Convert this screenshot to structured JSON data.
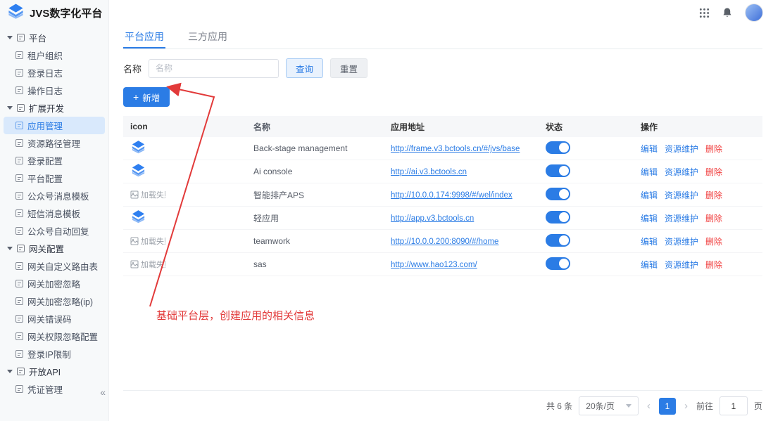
{
  "brand": {
    "title": "JVS数字化平台"
  },
  "sidebar": {
    "groups": [
      {
        "label": "平台",
        "items": [
          "租户组织",
          "登录日志",
          "操作日志"
        ]
      },
      {
        "label": "扩展开发",
        "items": [
          "应用管理",
          "资源路径管理",
          "登录配置",
          "平台配置",
          "公众号消息模板",
          "短信消息模板",
          "公众号自动回复"
        ]
      },
      {
        "label": "网关配置",
        "items": [
          "网关自定义路由表",
          "网关加密忽略",
          "网关加密忽略(ip)",
          "网关错误码",
          "网关权限忽略配置",
          "登录IP限制"
        ]
      },
      {
        "label": "开放API",
        "items": [
          "凭证管理"
        ]
      }
    ],
    "active_item": "应用管理",
    "collapse_glyph": "«"
  },
  "tabs": {
    "items": [
      {
        "label": "平台应用",
        "active": true
      },
      {
        "label": "三方应用",
        "active": false
      }
    ]
  },
  "search": {
    "label": "名称",
    "input_placeholder": "名称",
    "query_button": "查询",
    "reset_button": "重置"
  },
  "toolbar": {
    "plus_glyph": "+",
    "add_label": "新增"
  },
  "annotation": {
    "text": "基础平台层，创建应用的相关信息"
  },
  "table": {
    "columns": [
      "icon",
      "名称",
      "应用地址",
      "状态",
      "操作"
    ],
    "action_labels": {
      "edit": "编辑",
      "maintain": "资源维护",
      "delete": "删除"
    },
    "broken_icon_text": "加载失败",
    "rows": [
      {
        "icon": "jvs",
        "name": "Back-stage management",
        "url": "http://frame.v3.bctools.cn/#/jvs/base",
        "status": "on"
      },
      {
        "icon": "jvs",
        "name": "Ai console",
        "url": "http://ai.v3.bctools.cn",
        "status": "on"
      },
      {
        "icon": "broken",
        "name": "智能排产APS",
        "url": "http://10.0.0.174:9998/#/wel/index",
        "status": "on"
      },
      {
        "icon": "jvs",
        "name": "轻应用",
        "url": "http://app.v3.bctools.cn",
        "status": "on"
      },
      {
        "icon": "broken",
        "name": "teamwork",
        "url": "http://10.0.0.200:8090/#/home",
        "status": "on"
      },
      {
        "icon": "broken",
        "name": "sas",
        "url": "http://www.hao123.com/",
        "status": "on"
      }
    ]
  },
  "pagination": {
    "total": "共 6 条",
    "page_size": "20条/页",
    "prev_glyph": "‹",
    "next_glyph": "›",
    "current_page": "1",
    "goto_label": "前往",
    "goto_value": "1",
    "page_unit": "页"
  },
  "colors": {
    "primary": "#2b7ce5",
    "danger": "#f03e3e",
    "annotation": "#e23a3a"
  }
}
